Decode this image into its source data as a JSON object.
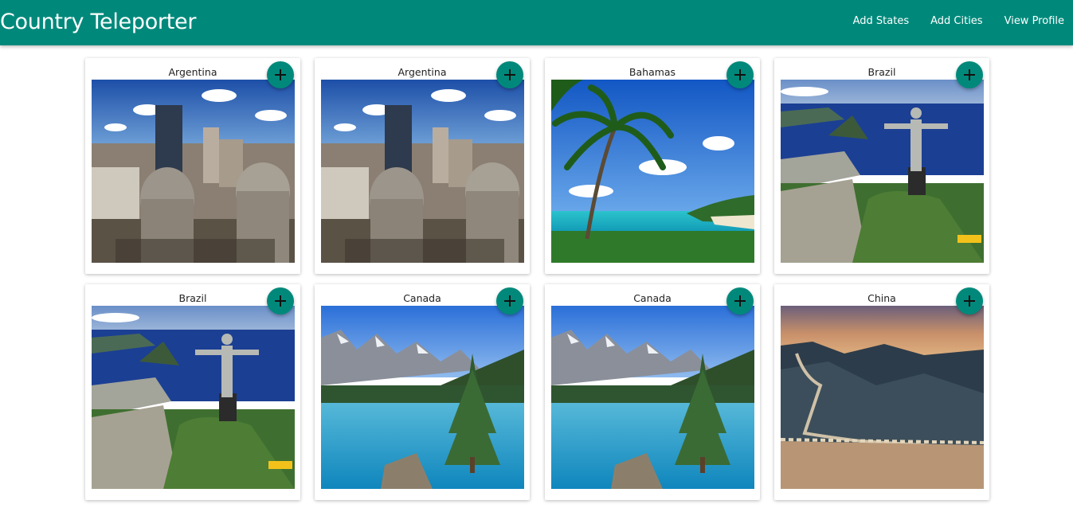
{
  "navbar": {
    "brand": "Country Teleporter",
    "links": [
      "Add States",
      "Add Cities",
      "View Profile"
    ],
    "color": "#00897b"
  },
  "cards": [
    {
      "country": "Argentina",
      "photo": "buenos-aires-city"
    },
    {
      "country": "Argentina",
      "photo": "buenos-aires-city"
    },
    {
      "country": "Bahamas",
      "photo": "palm-beach"
    },
    {
      "country": "Brazil",
      "photo": "christ-the-redeemer"
    },
    {
      "country": "Brazil",
      "photo": "christ-the-redeemer"
    },
    {
      "country": "Canada",
      "photo": "moraine-lake"
    },
    {
      "country": "Canada",
      "photo": "moraine-lake"
    },
    {
      "country": "China",
      "photo": "great-wall"
    }
  ],
  "add_button_icon": "plus-icon"
}
